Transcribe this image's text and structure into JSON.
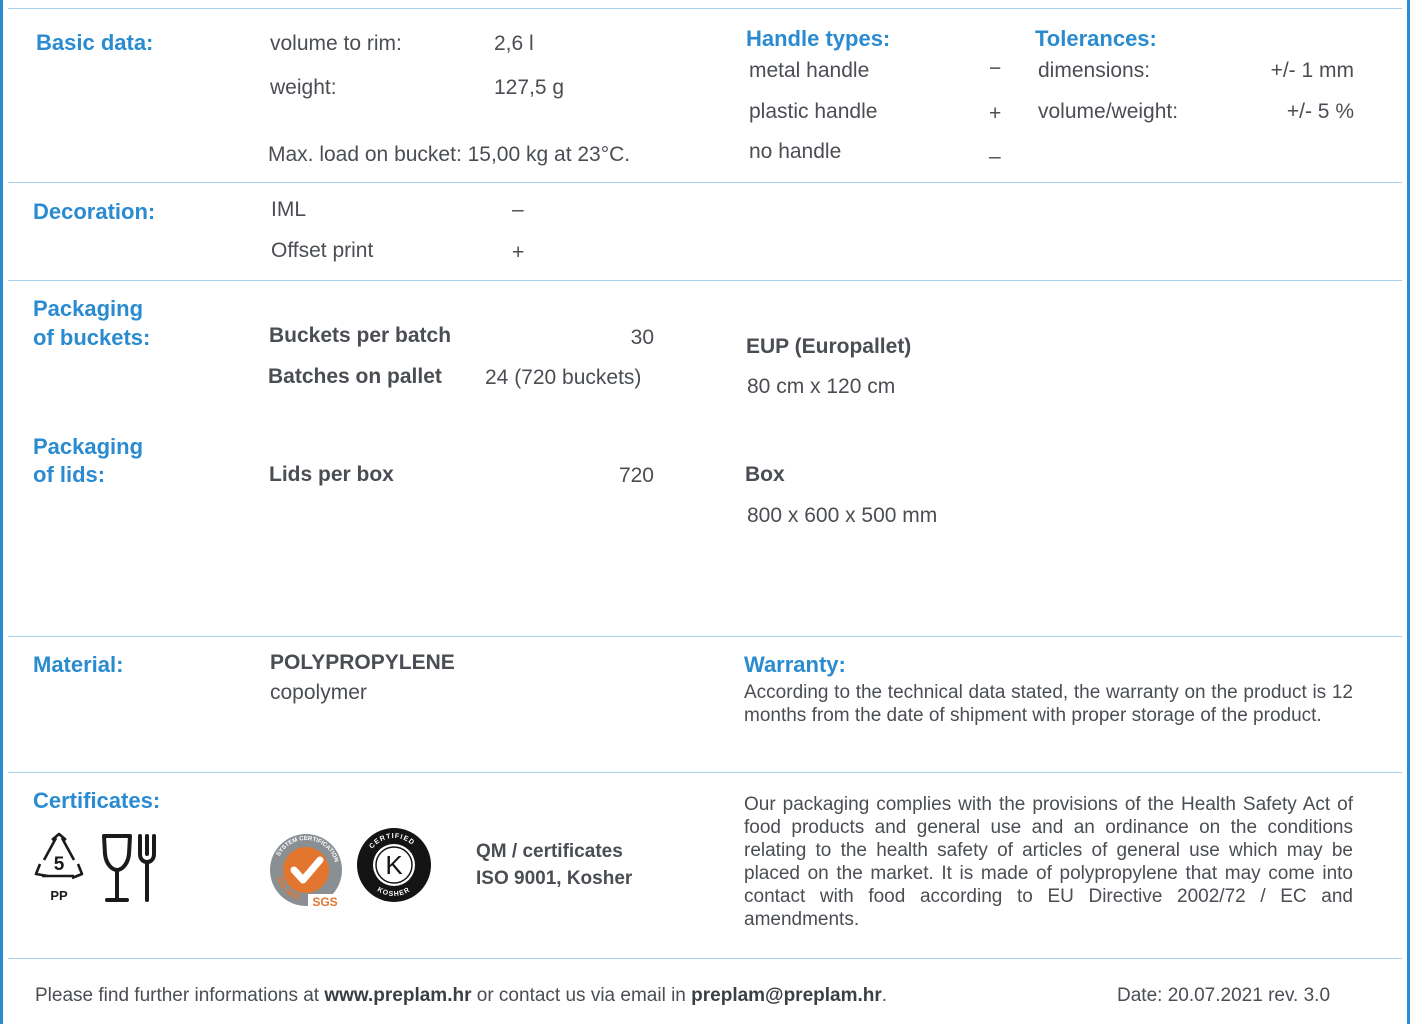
{
  "basic": {
    "heading": "Basic data:",
    "volume_label": "volume to rim:",
    "volume_value": "2,6 l",
    "weight_label": "weight:",
    "weight_value": "127,5 g",
    "max_load": "Max. load on bucket: 15,00 kg at 23°C."
  },
  "handles": {
    "heading": "Handle types:",
    "items": [
      {
        "label": "metal handle",
        "mark": "−"
      },
      {
        "label": "plastic handle",
        "mark": "+"
      },
      {
        "label": "no handle",
        "mark": "–"
      }
    ]
  },
  "tolerances": {
    "heading": "Tolerances:",
    "items": [
      {
        "label": "dimensions:",
        "value": "+/- 1 mm"
      },
      {
        "label": "volume/weight:",
        "value": "+/- 5 %"
      }
    ]
  },
  "decoration": {
    "heading": "Decoration:",
    "items": [
      {
        "label": "IML",
        "mark": "–"
      },
      {
        "label": "Offset print",
        "mark": "+"
      }
    ]
  },
  "packaging_buckets": {
    "heading_line1": "Packaging",
    "heading_line2": "of buckets:",
    "per_batch_label": "Buckets per batch",
    "per_batch_value": "30",
    "on_pallet_label": "Batches on pallet",
    "on_pallet_value": "24 (720 buckets)",
    "pallet_title": "EUP (Europallet)",
    "pallet_size": "80 cm x 120 cm"
  },
  "packaging_lids": {
    "heading_line1": "Packaging",
    "heading_line2": "of lids:",
    "per_box_label": "Lids per box",
    "per_box_value": "720",
    "box_title": "Box",
    "box_size": "800 x 600 x 500 mm"
  },
  "material": {
    "heading": "Material:",
    "name": "POLYPROPYLENE",
    "type": "copolymer"
  },
  "warranty": {
    "heading": "Warranty:",
    "text": "According to the technical data stated, the warranty on the product is 12 months from the date of shipment with proper storage of the product."
  },
  "certificates": {
    "heading": "Certificates:",
    "recycle_number": "5",
    "recycle_code": "PP",
    "sgs_ring_text": "SYSTEM CERTIFICATION",
    "sgs_iso": "ISO 9001",
    "sgs_brand": "SGS",
    "kosher_top": "CERTIFIED",
    "kosher_bottom": "KOSHER",
    "kosher_letter": "K",
    "qm_line1": "QM / certificates",
    "qm_line2": "ISO 9001, Kosher",
    "compliance_text": "Our packaging complies with the provisions of the Health Safety Act of food products and general use and an ordinance on the conditions relating to the health safety of articles of general use which may be placed on the market. It is made of polypropylene that may come into contact with food according to EU Directive 2002/72 / EC and amendments."
  },
  "footer": {
    "prefix": "Please find further informations at ",
    "website": "www.preplam.hr",
    "middle": " or contact us via email in ",
    "email": "preplam@preplam.hr",
    "suffix": ".",
    "date": "Date: 20.07.2021 rev. 3.0"
  },
  "colors": {
    "accent": "#2a8bd1",
    "divider": "#a9d1ee",
    "text": "#4a4e53",
    "sgs_orange": "#e2762f"
  }
}
